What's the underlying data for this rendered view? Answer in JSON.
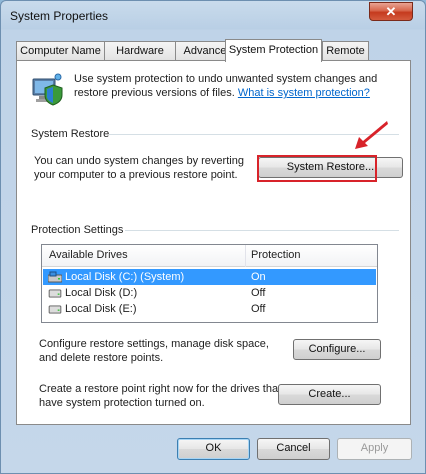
{
  "window": {
    "title": "System Properties",
    "close_symbol": "✕"
  },
  "tabs": [
    {
      "label": "Computer Name",
      "active": false
    },
    {
      "label": "Hardware",
      "active": false
    },
    {
      "label": "Advanced",
      "active": false
    },
    {
      "label": "System Protection",
      "active": true
    },
    {
      "label": "Remote",
      "active": false
    }
  ],
  "intro": {
    "text": "Use system protection to undo unwanted system changes and restore previous versions of files.",
    "link": "What is system protection?"
  },
  "system_restore": {
    "group_label": "System Restore",
    "description": "You can undo system changes by reverting your computer to a previous restore point.",
    "button_label": "System Restore..."
  },
  "protection_settings": {
    "group_label": "Protection Settings",
    "columns": [
      "Available Drives",
      "Protection"
    ],
    "drives": [
      {
        "name": "Local Disk (C:) (System)",
        "protection": "On",
        "selected": true,
        "icon": "system-drive-icon"
      },
      {
        "name": "Local Disk (D:)",
        "protection": "Off",
        "selected": false,
        "icon": "drive-icon"
      },
      {
        "name": "Local Disk (E:)",
        "protection": "Off",
        "selected": false,
        "icon": "drive-icon"
      }
    ],
    "configure_text": "Configure restore settings, manage disk space, and delete restore points.",
    "configure_button": "Configure...",
    "create_text": "Create a restore point right now for the drives that have system protection turned on.",
    "create_button": "Create..."
  },
  "footer": {
    "ok": "OK",
    "cancel": "Cancel",
    "apply": "Apply"
  },
  "colors": {
    "accent_highlight": "#d8232a",
    "selection": "#3399ff",
    "link": "#0066cc"
  }
}
